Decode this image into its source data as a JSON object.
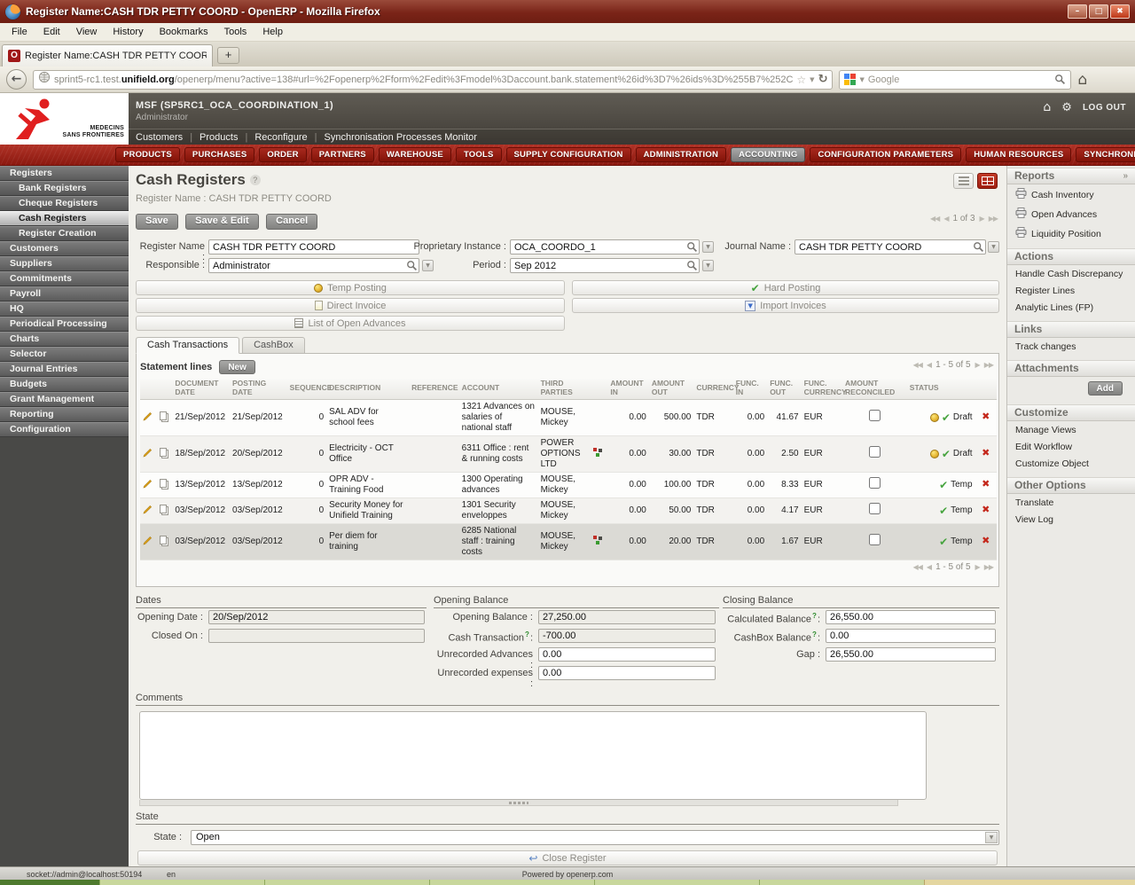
{
  "browser": {
    "window_title": "Register Name:CASH TDR PETTY COORD - OpenERP - Mozilla Firefox",
    "menu": [
      "File",
      "Edit",
      "View",
      "History",
      "Bookmarks",
      "Tools",
      "Help"
    ],
    "tab_title": "Register Name:CASH TDR PETTY COORD - ...",
    "url_prefix": "sprint5-rc1.test.",
    "url_domain": "unifield.org",
    "url_path": "/openerp/menu?active=138#url=%2Fopenerp%2Fform%2Fedit%3Fmodel%3Daccount.bank.statement%26id%3D7%26ids%3D%255B7%252C",
    "search_placeholder": "Google"
  },
  "header": {
    "logo_text_1": "MEDECINS",
    "logo_text_2": "SANS FRONTIERES",
    "instance": "MSF (SP5RC1_OCA_COORDINATION_1)",
    "user": "Administrator",
    "shortcuts": [
      "Customers",
      "Products",
      "Reconfigure",
      "Synchronisation Processes Monitor"
    ],
    "logout": "LOG OUT"
  },
  "nav": {
    "items": [
      "PRODUCTS",
      "PURCHASES",
      "ORDER",
      "PARTNERS",
      "WAREHOUSE",
      "TOOLS",
      "SUPPLY CONFIGURATION",
      "ADMINISTRATION",
      "ACCOUNTING",
      "CONFIGURATION PARAMETERS",
      "HUMAN RESOURCES",
      "SYNCHRONIZATION"
    ],
    "active": "ACCOUNTING"
  },
  "sidebar": {
    "items": [
      {
        "label": "Registers",
        "sub": false,
        "selected": false
      },
      {
        "label": "Bank Registers",
        "sub": true,
        "selected": false
      },
      {
        "label": "Cheque Registers",
        "sub": true,
        "selected": false
      },
      {
        "label": "Cash Registers",
        "sub": true,
        "selected": true
      },
      {
        "label": "Register Creation",
        "sub": true,
        "selected": false
      },
      {
        "label": "Customers",
        "sub": false,
        "selected": false
      },
      {
        "label": "Suppliers",
        "sub": false,
        "selected": false
      },
      {
        "label": "Commitments",
        "sub": false,
        "selected": false
      },
      {
        "label": "Payroll",
        "sub": false,
        "selected": false
      },
      {
        "label": "HQ",
        "sub": false,
        "selected": false
      },
      {
        "label": "Periodical Processing",
        "sub": false,
        "selected": false
      },
      {
        "label": "Charts",
        "sub": false,
        "selected": false
      },
      {
        "label": "Selector",
        "sub": false,
        "selected": false
      },
      {
        "label": "Journal Entries",
        "sub": false,
        "selected": false
      },
      {
        "label": "Budgets",
        "sub": false,
        "selected": false
      },
      {
        "label": "Grant Management",
        "sub": false,
        "selected": false
      },
      {
        "label": "Reporting",
        "sub": false,
        "selected": false
      },
      {
        "label": "Configuration",
        "sub": false,
        "selected": false
      }
    ]
  },
  "form": {
    "title": "Cash Registers",
    "subtitle": "Register Name : CASH TDR PETTY COORD",
    "save": "Save",
    "save_edit": "Save & Edit",
    "cancel": "Cancel",
    "pager": "1 of 3",
    "labels": {
      "register_name": "Register Name :",
      "proprietary_instance": "Proprietary Instance :",
      "journal_name": "Journal Name :",
      "responsible": "Responsible :",
      "period": "Period :"
    },
    "values": {
      "register_name": "CASH TDR PETTY COORD",
      "proprietary_instance": "OCA_COORDO_1",
      "journal_name": "CASH TDR PETTY COORD",
      "responsible": "Administrator",
      "period": "Sep 2012"
    },
    "buttons": {
      "temp_posting": "Temp Posting",
      "hard_posting": "Hard Posting",
      "direct_invoice": "Direct Invoice",
      "import_invoices": "Import Invoices",
      "list_open_advances": "List of Open Advances"
    },
    "tabs": [
      "Cash Transactions",
      "CashBox"
    ],
    "active_tab": "Cash Transactions"
  },
  "statement": {
    "label": "Statement lines",
    "new_button": "New",
    "pager": "1 - 5 of 5",
    "columns": [
      "DOCUMENT DATE",
      "POSTING DATE",
      "SEQUENCE",
      "DESCRIPTION",
      "REFERENCE",
      "ACCOUNT",
      "THIRD PARTIES",
      "AMOUNT IN",
      "AMOUNT OUT",
      "CURRENCY",
      "FUNC. IN",
      "FUNC. OUT",
      "FUNC. CURRENCY",
      "AMOUNT RECONCILED",
      "STATUS"
    ],
    "rows": [
      {
        "doc_date": "21/Sep/2012",
        "post_date": "21/Sep/2012",
        "seq": "0",
        "desc": "SAL ADV for school fees",
        "ref": "",
        "account": "1321 Advances on salaries of national staff",
        "third": "MOUSE, Mickey",
        "picon": false,
        "in": "0.00",
        "out": "500.00",
        "cur": "TDR",
        "fin": "0.00",
        "fout": "41.67",
        "fcur": "EUR",
        "status": "Draft",
        "coin": true,
        "selected": false
      },
      {
        "doc_date": "18/Sep/2012",
        "post_date": "20/Sep/2012",
        "seq": "0",
        "desc": "Electricity - OCT Office",
        "ref": "",
        "account": "6311 Office : rent & running costs",
        "third": "POWER OPTIONS LTD",
        "picon": true,
        "in": "0.00",
        "out": "30.00",
        "cur": "TDR",
        "fin": "0.00",
        "fout": "2.50",
        "fcur": "EUR",
        "status": "Draft",
        "coin": true,
        "selected": false
      },
      {
        "doc_date": "13/Sep/2012",
        "post_date": "13/Sep/2012",
        "seq": "0",
        "desc": "OPR ADV - Training Food",
        "ref": "",
        "account": "1300 Operating advances",
        "third": "MOUSE, Mickey",
        "picon": false,
        "in": "0.00",
        "out": "100.00",
        "cur": "TDR",
        "fin": "0.00",
        "fout": "8.33",
        "fcur": "EUR",
        "status": "Temp",
        "coin": false,
        "selected": false
      },
      {
        "doc_date": "03/Sep/2012",
        "post_date": "03/Sep/2012",
        "seq": "0",
        "desc": "Security Money for Unifield Training",
        "ref": "",
        "account": "1301 Security enveloppes",
        "third": "MOUSE, Mickey",
        "picon": false,
        "in": "0.00",
        "out": "50.00",
        "cur": "TDR",
        "fin": "0.00",
        "fout": "4.17",
        "fcur": "EUR",
        "status": "Temp",
        "coin": false,
        "selected": false
      },
      {
        "doc_date": "03/Sep/2012",
        "post_date": "03/Sep/2012",
        "seq": "0",
        "desc": "Per diem for training",
        "ref": "",
        "account": "6285 National staff : training costs",
        "third": "MOUSE, Mickey",
        "picon": true,
        "in": "0.00",
        "out": "20.00",
        "cur": "TDR",
        "fin": "0.00",
        "fout": "1.67",
        "fcur": "EUR",
        "status": "Temp",
        "coin": false,
        "selected": true
      }
    ]
  },
  "groups": {
    "dates": {
      "title": "Dates",
      "opening_date_label": "Opening Date :",
      "opening_date": "20/Sep/2012",
      "closed_on_label": "Closed On :",
      "closed_on": ""
    },
    "opening_balance": {
      "title": "Opening Balance",
      "opening_balance_label": "Opening Balance :",
      "opening_balance": "27,250.00",
      "cash_transaction_label": "Cash Transaction",
      "cash_transaction": "-700.00",
      "unrecorded_advances_label": "Unrecorded Advances :",
      "unrecorded_advances": "0.00",
      "unrecorded_expenses_label": "Unrecorded expenses :",
      "unrecorded_expenses": "0.00"
    },
    "closing_balance": {
      "title": "Closing Balance",
      "calculated_balance_label": "Calculated Balance",
      "calculated_balance": "26,550.00",
      "cashbox_balance_label": "CashBox Balance",
      "cashbox_balance": "0.00",
      "gap_label": "Gap :",
      "gap": "26,550.00"
    },
    "comments": {
      "title": "Comments",
      "value": ""
    },
    "state": {
      "title": "State",
      "label": "State :",
      "value": "Open",
      "close_button": "Close Register"
    }
  },
  "right_sidebar": {
    "sections": [
      {
        "title": "Reports",
        "collapse_icon": "»",
        "items": [
          {
            "label": "Cash Inventory",
            "icon": "printer-icon"
          },
          {
            "label": "Open Advances",
            "icon": "printer-icon"
          },
          {
            "label": "Liquidity Position",
            "icon": "printer-icon"
          }
        ]
      },
      {
        "title": "Actions",
        "items": [
          {
            "label": "Handle Cash Discrepancy"
          },
          {
            "label": "Register Lines"
          },
          {
            "label": "Analytic Lines (FP)"
          }
        ]
      },
      {
        "title": "Links",
        "items": [
          {
            "label": "Track changes"
          }
        ]
      },
      {
        "title": "Attachments",
        "items": [],
        "button": "Add"
      },
      {
        "title": "Customize",
        "items": [
          {
            "label": "Manage Views"
          },
          {
            "label": "Edit Workflow"
          },
          {
            "label": "Customize Object"
          }
        ]
      },
      {
        "title": "Other Options",
        "items": [
          {
            "label": "Translate"
          },
          {
            "label": "View Log"
          }
        ]
      }
    ]
  },
  "footer": {
    "socket": "socket://admin@localhost:50194",
    "lang": "en",
    "powered": "Powered by openerp.com"
  },
  "ui": {
    "colon": ":"
  },
  "icons": {
    "help": "?",
    "home": "⌂",
    "gear": "⚙",
    "check": "✔",
    "cross": "✖",
    "star": "☆",
    "reload": "↻",
    "dropdown": "▼",
    "back": "←",
    "close_register": "↩",
    "win_min": "–",
    "win_max": "□",
    "win_close": "✖",
    "favicon": "O",
    "new_tab": "+"
  },
  "colors": {
    "brand_red": "#A2241A",
    "msf_red": "#E01F1F",
    "status_green": "#47A43F",
    "status_red": "#C4281C",
    "coin_gold": "#E8B934"
  }
}
